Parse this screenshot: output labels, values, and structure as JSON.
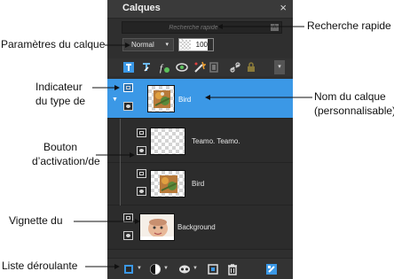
{
  "panel": {
    "title": "Calques",
    "close_glyph": "×",
    "search_placeholder": "Recherche rapide",
    "search_clear_glyph": "A",
    "blend_mode": "Normal",
    "opacity": "100"
  },
  "toolbar": {
    "icons": [
      "new-raster-layer-icon",
      "new-vector-layer-icon",
      "new-adjustment-layer-icon",
      "mask-icon",
      "effects-icon",
      "group-icon",
      "link-icon",
      "lock-icon"
    ],
    "dropdown_glyph": "▾"
  },
  "layers": [
    {
      "name": "Bird",
      "selected": true,
      "thumb": "bird"
    },
    {
      "name": "Teamo. Teamo.",
      "selected": false,
      "thumb": "transparent"
    },
    {
      "name": "Bird",
      "selected": false,
      "thumb": "bird"
    },
    {
      "name": "Background",
      "selected": false,
      "thumb": "baby"
    }
  ],
  "bottom_toolbar": {
    "icons": [
      "new-layer-dropdown-icon",
      "blend-circle-icon",
      "mask-dropdown-icon",
      "merge-icon",
      "delete-icon",
      "properties-icon"
    ]
  },
  "annotations": {
    "search": "Recherche rapide",
    "layer_settings": "Paramètres du calque",
    "type_indicator_1": "Indicateur",
    "type_indicator_2": "du type de",
    "layer_name_1": "Nom du calque",
    "layer_name_2": "(personnalisable)",
    "toggle_1": "Bouton",
    "toggle_2": "d’activation/de",
    "thumbnail": "Vignette du",
    "dropdown": "Liste déroulante"
  },
  "colors": {
    "panel_bg": "#2f2f2f",
    "selected": "#3b98e6"
  }
}
